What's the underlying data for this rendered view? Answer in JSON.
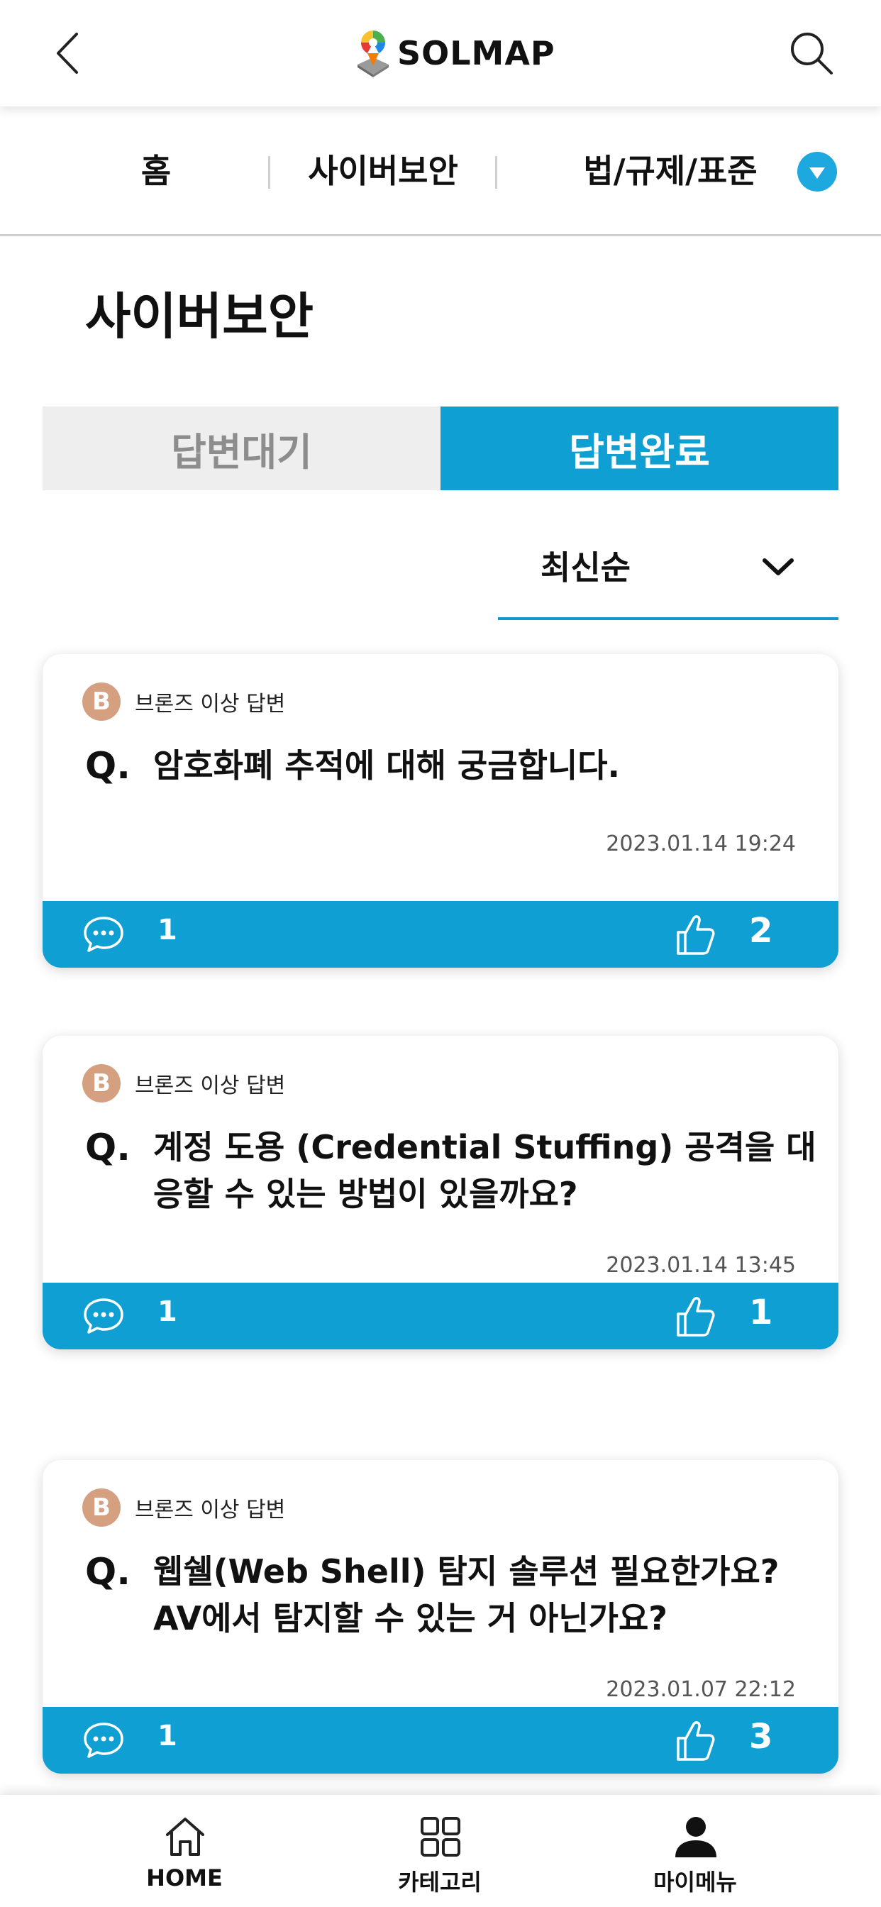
{
  "app": {
    "logo_text": "SOLMAP"
  },
  "header": {
    "back_icon": "chevron-left-icon",
    "search_icon": "search-icon"
  },
  "category_nav": {
    "items": [
      "홈",
      "사이버보안",
      "법/규제/표준"
    ],
    "expand_icon": "triangle-down-icon"
  },
  "page_title": "사이버보안",
  "segment": {
    "tabs": [
      "답변대기",
      "답변완료"
    ],
    "active_index": 1
  },
  "sort": {
    "selected": "최신순",
    "icon": "chevron-down-icon"
  },
  "questions": [
    {
      "badge_letter": "B",
      "badge_text": "브론즈 이상 답변",
      "q_prefix": "Q.",
      "title": "암호화폐 추적에 대해 궁금합니다.",
      "date": "2023.01.14 19:24",
      "comments": "1",
      "likes": "2"
    },
    {
      "badge_letter": "B",
      "badge_text": "브론즈 이상 답변",
      "q_prefix": "Q.",
      "title": "계정 도용 (Credential Stuffing) 공격을 대응할 수 있는 방법이 있을까요?",
      "date": "2023.01.14 13:45",
      "comments": "1",
      "likes": "1"
    },
    {
      "badge_letter": "B",
      "badge_text": "브론즈 이상 답변",
      "q_prefix": "Q.",
      "title": "웹쉘(Web Shell) 탐지 솔루션 필요한가요? AV에서 탐지할 수 있는 거 아닌가요?",
      "date": "2023.01.07 22:12",
      "comments": "1",
      "likes": "3"
    }
  ],
  "bottom_nav": {
    "items": [
      {
        "label": "HOME",
        "icon": "home-icon"
      },
      {
        "label": "카테고리",
        "icon": "grid-icon"
      },
      {
        "label": "마이메뉴",
        "icon": "user-icon"
      }
    ]
  },
  "colors": {
    "accent": "#0f9fd3",
    "badge_bronze": "#d4a080",
    "tab_inactive": "#eeeeee"
  }
}
